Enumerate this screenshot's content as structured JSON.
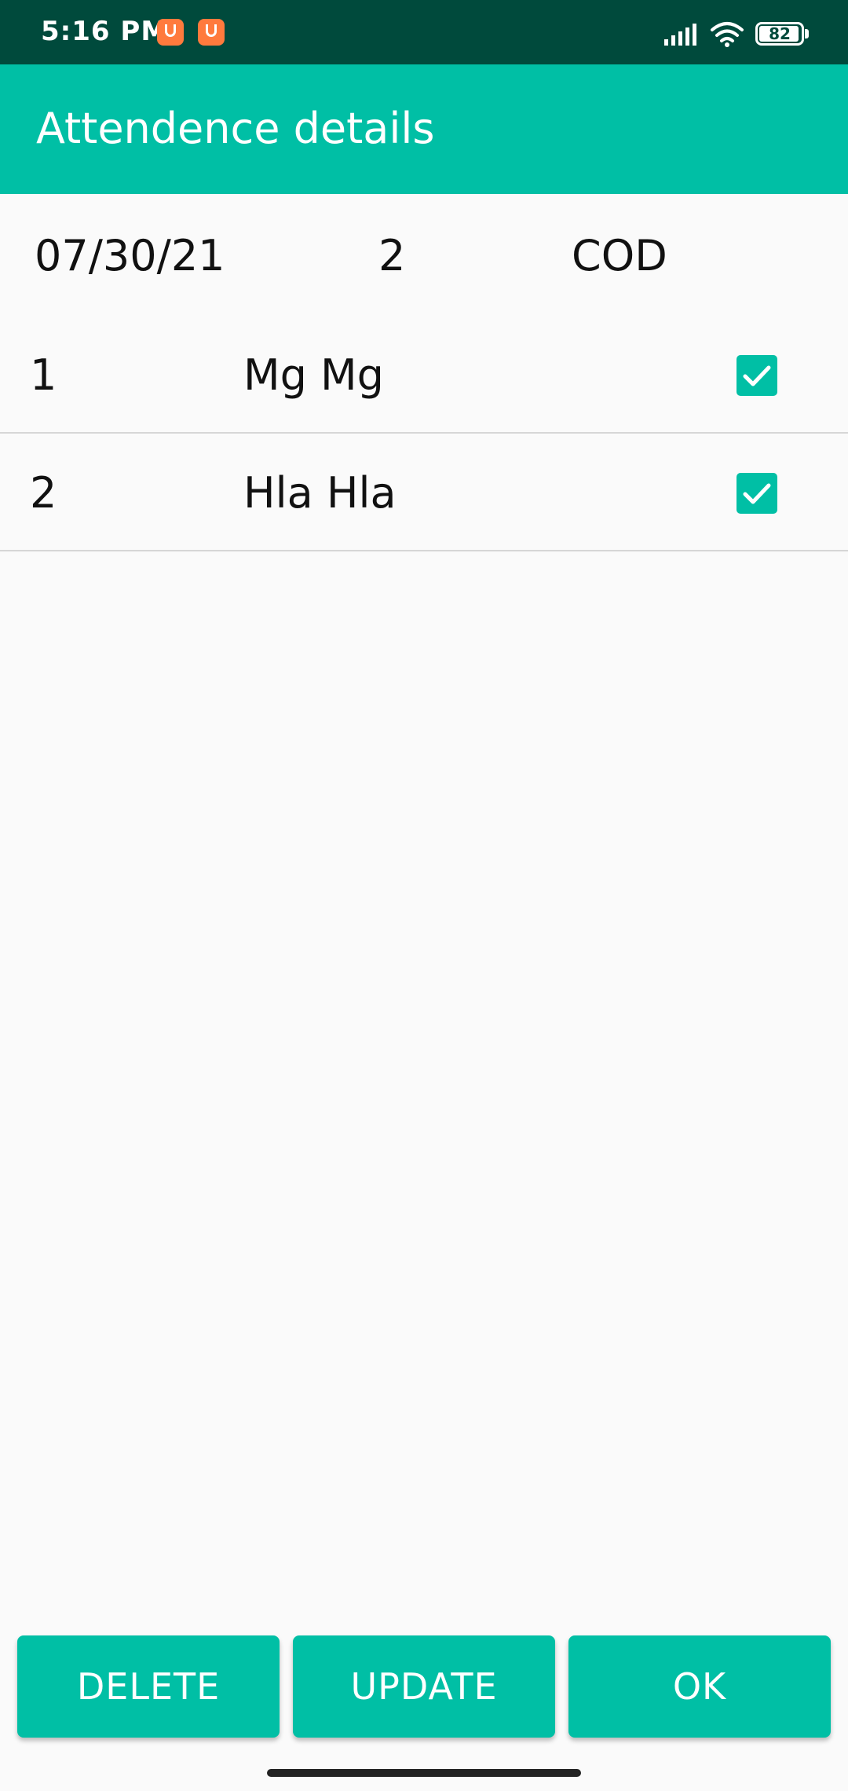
{
  "status_bar": {
    "time": "5:16 PM",
    "battery_level": "82",
    "icons": [
      "notification-app-icon",
      "notification-app-icon",
      "signal-icon",
      "wifi-icon",
      "battery-icon"
    ],
    "background_color": "#004a3c"
  },
  "app_bar": {
    "title": "Attendence details",
    "background_color": "#00bfa5"
  },
  "summary": {
    "date": "07/30/21",
    "count": "2",
    "subject": "COD"
  },
  "students": [
    {
      "number": "1",
      "name": "Mg Mg",
      "present": true
    },
    {
      "number": "2",
      "name": "Hla Hla",
      "present": true
    }
  ],
  "buttons": {
    "delete": "DELETE",
    "update": "UPDATE",
    "ok": "OK"
  },
  "accent_color": "#00bfa5"
}
